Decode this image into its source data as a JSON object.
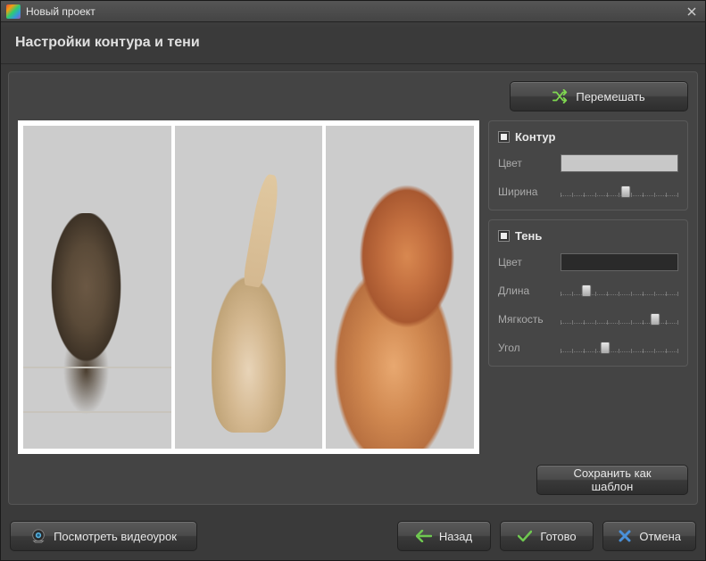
{
  "window": {
    "title": "Новый проект"
  },
  "header": {
    "title": "Настройки контура и тени"
  },
  "actions": {
    "shuffle": "Перемешать",
    "save_template": "Сохранить как шаблон"
  },
  "panels": {
    "contour": {
      "title": "Контур",
      "checked": true,
      "color_label": "Цвет",
      "color_value": "#c8c8c8",
      "width_label": "Ширина",
      "width_value": 55
    },
    "shadow": {
      "title": "Тень",
      "checked": true,
      "color_label": "Цвет",
      "color_value": "#2a2a2a",
      "length_label": "Длина",
      "length_value": 22,
      "softness_label": "Мягкость",
      "softness_value": 80,
      "angle_label": "Угол",
      "angle_value": 38
    }
  },
  "footer": {
    "video": "Посмотреть видеоурок",
    "back": "Назад",
    "done": "Готово",
    "cancel": "Отмена"
  }
}
